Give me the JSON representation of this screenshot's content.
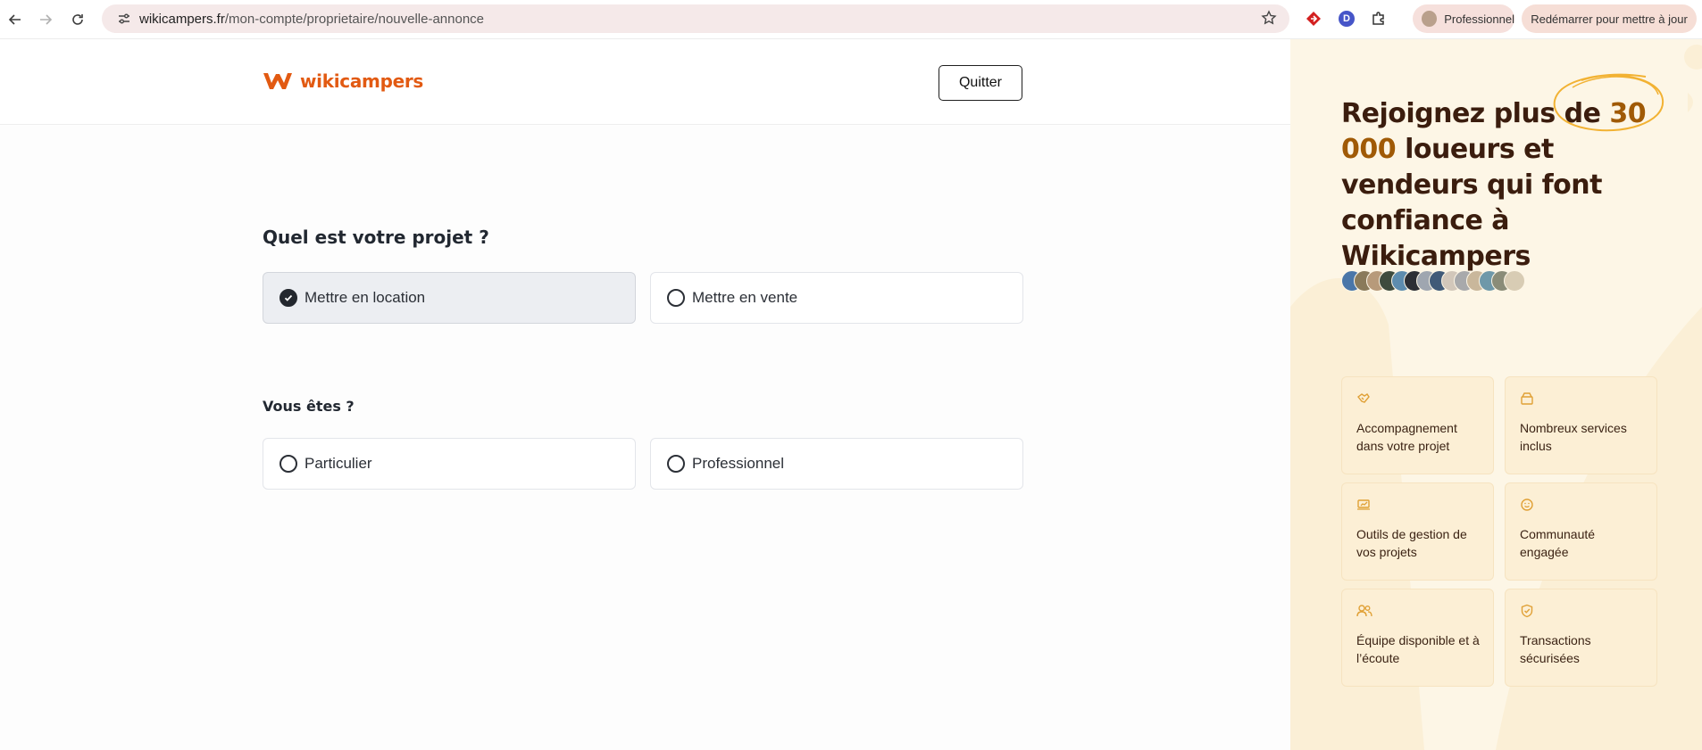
{
  "browser": {
    "url_domain": "wikicampers.fr",
    "url_path": "/mon-compte/proprietaire/nouvelle-annonce",
    "profile_label": "Professionnel",
    "update_label": "Redémarrer pour mettre à jour",
    "ext_d_letter": "D"
  },
  "header": {
    "brand": "wikicampers",
    "quit_label": "Quitter"
  },
  "form": {
    "project_question": "Quel est votre projet ?",
    "project_options": [
      {
        "label": "Mettre en location",
        "selected": true
      },
      {
        "label": "Mettre en vente",
        "selected": false
      }
    ],
    "user_question": "Vous êtes ?",
    "user_options": [
      {
        "label": "Particulier",
        "selected": false
      },
      {
        "label": "Professionnel",
        "selected": false
      }
    ]
  },
  "side": {
    "title_before": "Rejoignez plus de ",
    "title_highlight": "30 000",
    "title_after": " loueurs et vendeurs qui font confiance à Wikicampers",
    "accent_color": "#a05a06",
    "features": [
      {
        "label": "Accompagnement dans votre projet",
        "icon": "handshake-icon"
      },
      {
        "label": "Nombreux services inclus",
        "icon": "box-icon"
      },
      {
        "label": "Outils de gestion de vos projets",
        "icon": "laptop-chart-icon"
      },
      {
        "label": "Communauté engagée",
        "icon": "smile-icon"
      },
      {
        "label": "Équipe disponible et à l’écoute",
        "icon": "users-icon"
      },
      {
        "label": "Transactions sécurisées",
        "icon": "shield-check-icon"
      }
    ]
  }
}
